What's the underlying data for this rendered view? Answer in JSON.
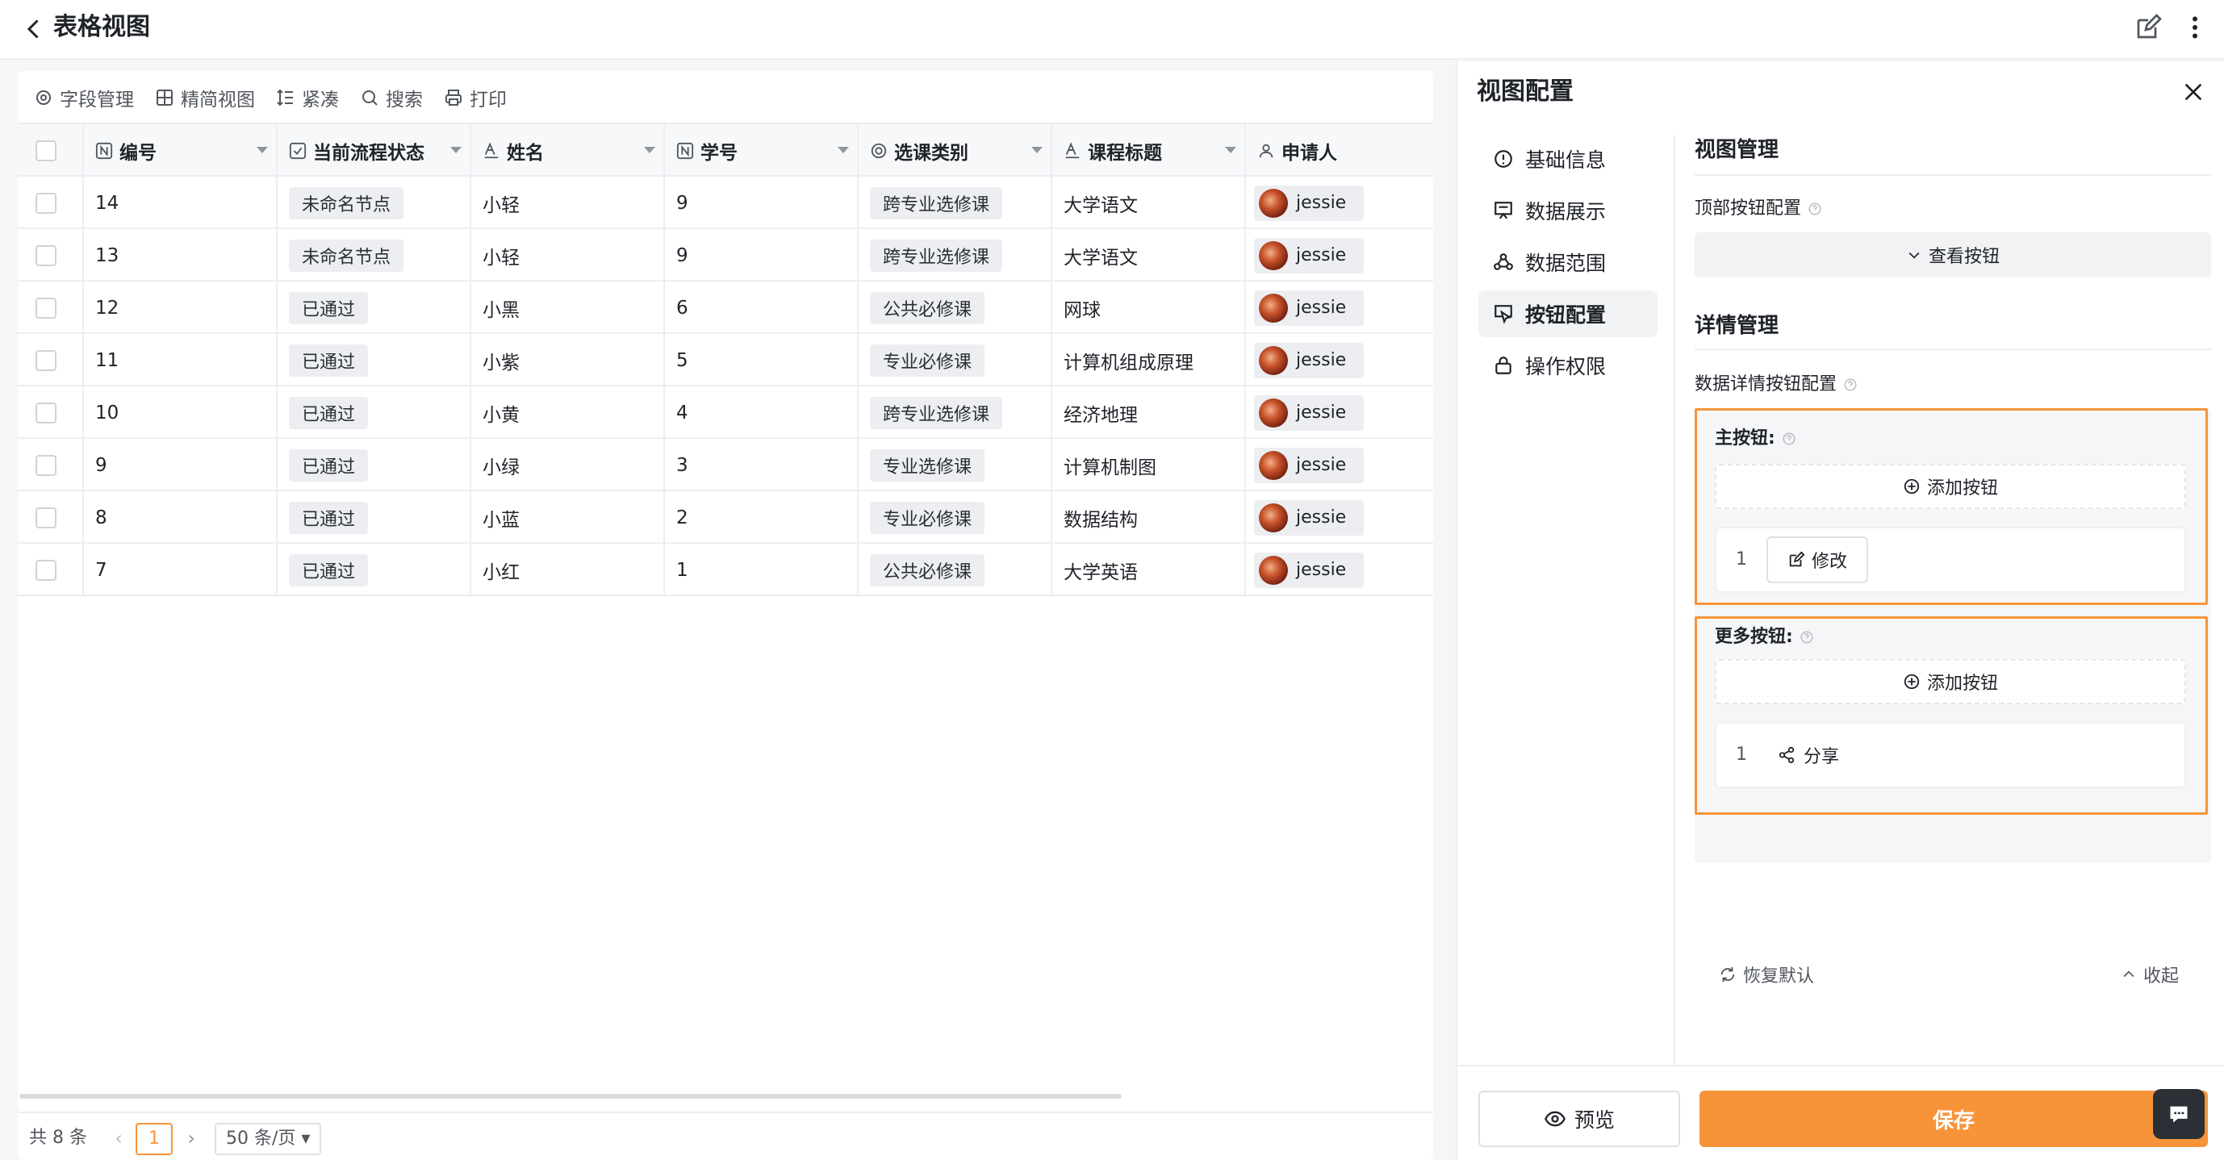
{
  "header": {
    "title": "表格视图"
  },
  "toolbar": {
    "items": [
      {
        "label": "字段管理",
        "icon": "field-settings-icon"
      },
      {
        "label": "精简视图",
        "icon": "grid-icon"
      },
      {
        "label": "紧凑",
        "icon": "row-height-icon"
      },
      {
        "label": "搜索",
        "icon": "search-icon"
      },
      {
        "label": "打印",
        "icon": "print-icon"
      }
    ]
  },
  "table": {
    "columns": [
      {
        "label": "编号",
        "icon": "number-field-icon"
      },
      {
        "label": "当前流程状态",
        "icon": "checkbox-field-icon"
      },
      {
        "label": "姓名",
        "icon": "text-field-icon"
      },
      {
        "label": "学号",
        "icon": "number-field-icon"
      },
      {
        "label": "选课类别",
        "icon": "option-field-icon"
      },
      {
        "label": "课程标题",
        "icon": "text-field-icon"
      },
      {
        "label": "申请人",
        "icon": "user-field-icon"
      }
    ],
    "rows": [
      {
        "id": "14",
        "status": "未命名节点",
        "name": "小轻",
        "student_no": "9",
        "category": "跨专业选修课",
        "course": "大学语文",
        "applicant": "jessie"
      },
      {
        "id": "13",
        "status": "未命名节点",
        "name": "小轻",
        "student_no": "9",
        "category": "跨专业选修课",
        "course": "大学语文",
        "applicant": "jessie"
      },
      {
        "id": "12",
        "status": "已通过",
        "name": "小黑",
        "student_no": "6",
        "category": "公共必修课",
        "course": "网球",
        "applicant": "jessie"
      },
      {
        "id": "11",
        "status": "已通过",
        "name": "小紫",
        "student_no": "5",
        "category": "专业必修课",
        "course": "计算机组成原理",
        "applicant": "jessie"
      },
      {
        "id": "10",
        "status": "已通过",
        "name": "小黄",
        "student_no": "4",
        "category": "跨专业选修课",
        "course": "经济地理",
        "applicant": "jessie"
      },
      {
        "id": "9",
        "status": "已通过",
        "name": "小绿",
        "student_no": "3",
        "category": "专业选修课",
        "course": "计算机制图",
        "applicant": "jessie"
      },
      {
        "id": "8",
        "status": "已通过",
        "name": "小蓝",
        "student_no": "2",
        "category": "专业必修课",
        "course": "数据结构",
        "applicant": "jessie"
      },
      {
        "id": "7",
        "status": "已通过",
        "name": "小红",
        "student_no": "1",
        "category": "公共必修课",
        "course": "大学英语",
        "applicant": "jessie"
      }
    ]
  },
  "pagination": {
    "total": "共 8 条",
    "current": "1",
    "page_size": "50 条/页"
  },
  "panel": {
    "title": "视图配置",
    "nav": [
      {
        "label": "基础信息",
        "icon": "info-icon",
        "active": false
      },
      {
        "label": "数据展示",
        "icon": "display-icon",
        "active": false
      },
      {
        "label": "数据范围",
        "icon": "scope-icon",
        "active": false
      },
      {
        "label": "按钮配置",
        "icon": "button-config-icon",
        "active": true
      },
      {
        "label": "操作权限",
        "icon": "lock-icon",
        "active": false
      }
    ],
    "view_mgmt": {
      "title": "视图管理",
      "top_btn_label": "顶部按钮配置",
      "view_btn": "查看按钮"
    },
    "detail_mgmt": {
      "title": "详情管理",
      "detail_btn_label": "数据详情按钮配置",
      "primary": {
        "label": "主按钮:",
        "add": "添加按钮",
        "items": [
          {
            "index": "1",
            "label": "修改",
            "icon": "edit-icon"
          }
        ]
      },
      "more": {
        "label": "更多按钮:",
        "add": "添加按钮",
        "items": [
          {
            "index": "1",
            "label": "分享",
            "icon": "share-icon"
          }
        ]
      },
      "restore": "恢复默认",
      "collapse": "收起"
    },
    "footer": {
      "preview": "预览",
      "save": "保存"
    }
  },
  "colors": {
    "accent": "#f7943a",
    "tag_bg": "#eceef1",
    "text": "#1f2329"
  }
}
